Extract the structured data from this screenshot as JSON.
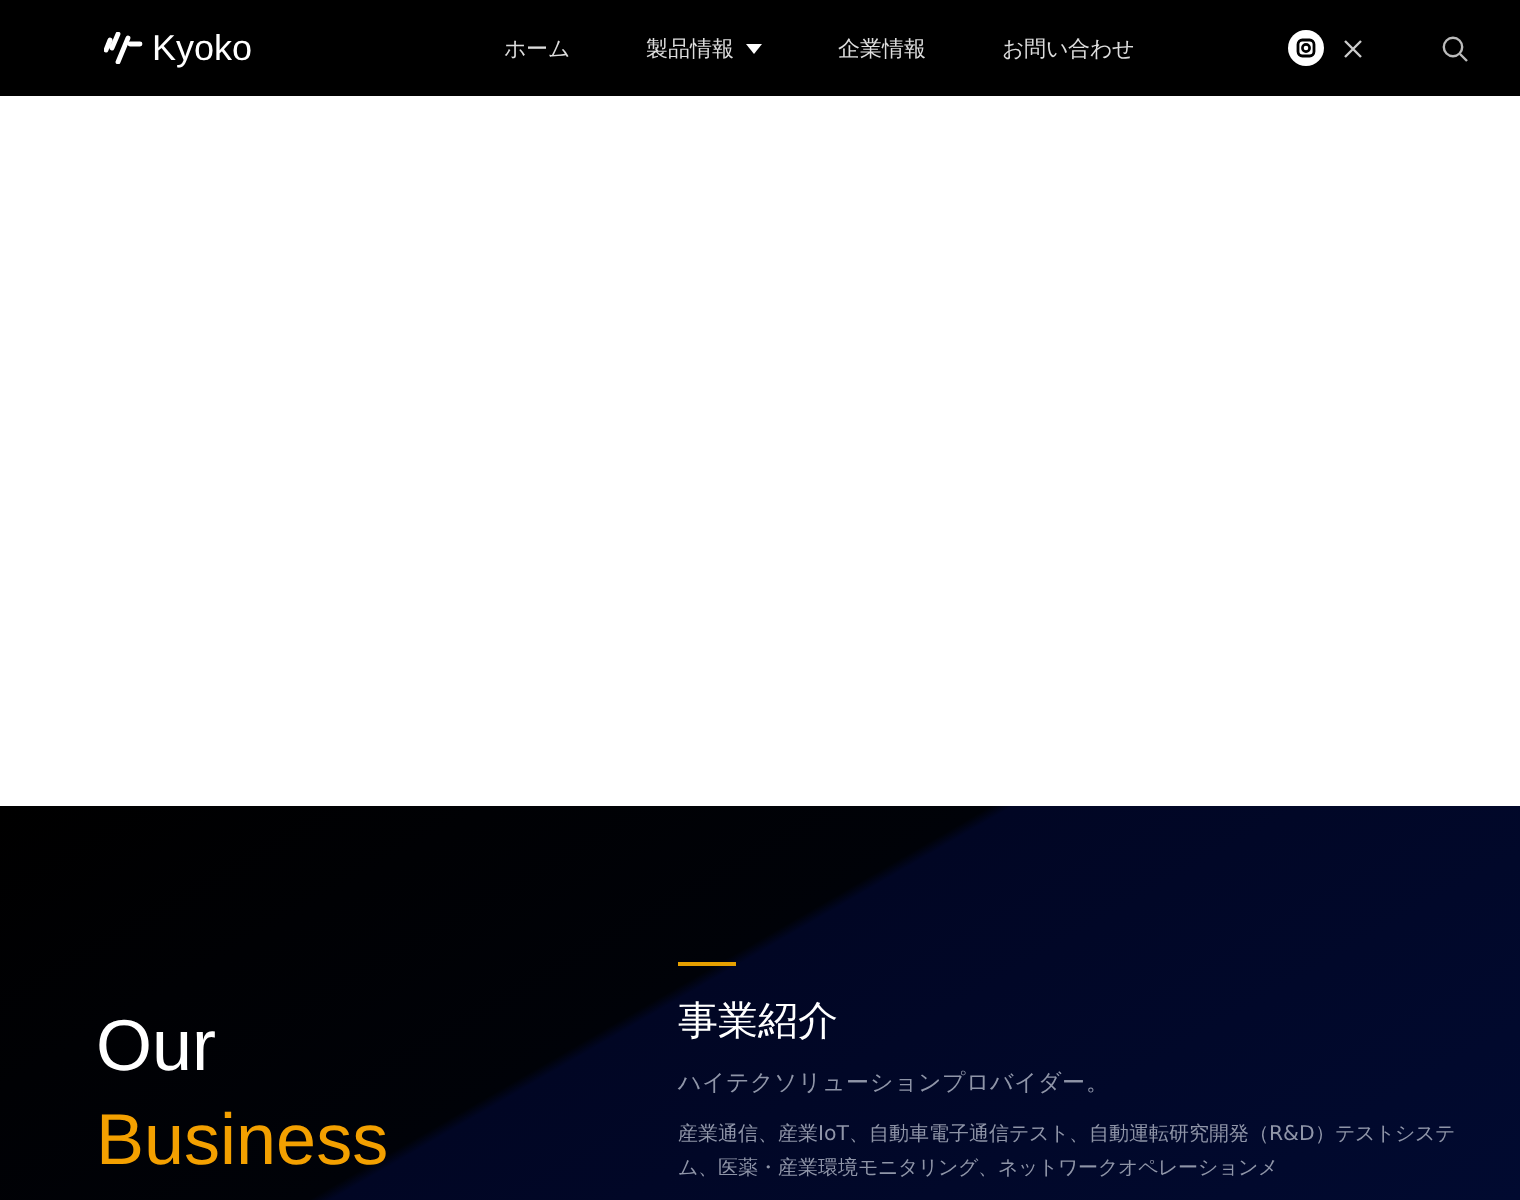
{
  "header": {
    "logo": "Kyoko",
    "nav": [
      {
        "label": "ホーム",
        "dropdown": false
      },
      {
        "label": "製品情報",
        "dropdown": true
      },
      {
        "label": "企業情報",
        "dropdown": false
      },
      {
        "label": "お問い合わせ",
        "dropdown": false
      }
    ]
  },
  "section": {
    "heading_line1": "Our",
    "heading_line2": "Business",
    "title": "事業紹介",
    "subtitle": "ハイテクソリューションプロバイダー。",
    "body": "産業通信、産業IoT、自動車電子通信テスト、自動運転研究開発（R&D）テストシステム、医薬・産業環境モニタリング、ネットワークオペレーションメ"
  }
}
